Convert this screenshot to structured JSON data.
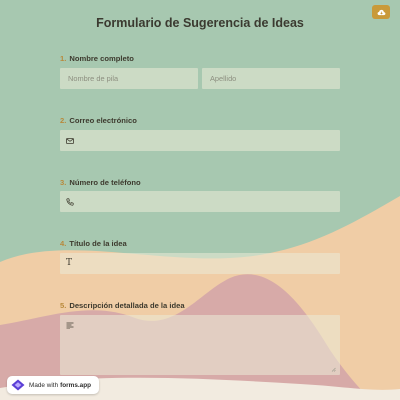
{
  "form": {
    "title": "Formulario de Sugerencia de Ideas",
    "questions": [
      {
        "number": "1.",
        "label": "Nombre completo"
      },
      {
        "number": "2.",
        "label": "Correo electrónico"
      },
      {
        "number": "3.",
        "label": "Número de teléfono"
      },
      {
        "number": "4.",
        "label": "Título de la idea"
      },
      {
        "number": "5.",
        "label": "Descripción detallada de la idea"
      }
    ],
    "first_name_placeholder": "Nombre de pila",
    "last_name_placeholder": "Apellido",
    "title_field_icon_char": "T"
  },
  "footer": {
    "made_with": "Made with",
    "brand": "forms.app"
  },
  "icons": {
    "top_right": "cloud-icon",
    "email": "envelope-icon",
    "phone": "phone-icon",
    "title": "text-t-icon",
    "description": "paragraph-lines-icon",
    "footer": "forms-app-logo-icon"
  },
  "colors": {
    "accent": "#b8893b",
    "top_button": "#c99a3a",
    "background_green": "#a7c8b0",
    "background_peach": "#f0cda6",
    "background_pink": "#d7aaa8"
  }
}
